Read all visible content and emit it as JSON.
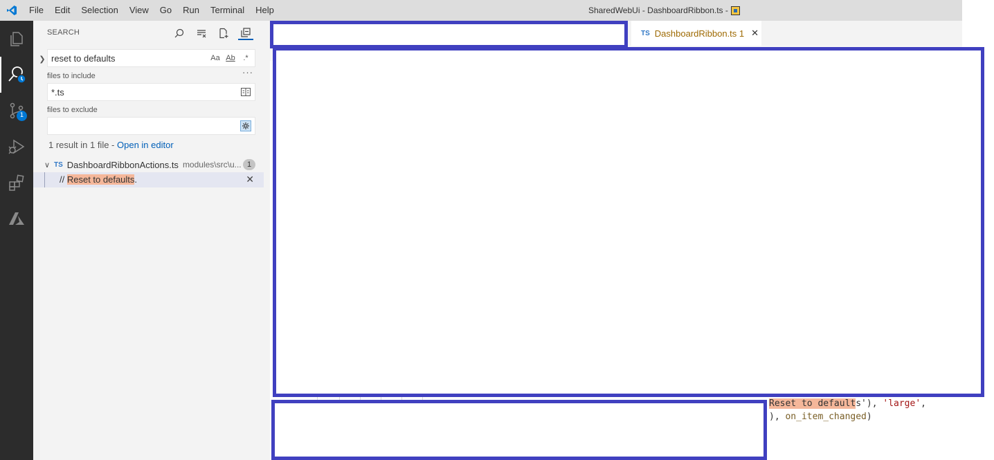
{
  "titlebar": {
    "menu": [
      "File",
      "Edit",
      "Selection",
      "View",
      "Go",
      "Run",
      "Terminal",
      "Help"
    ],
    "window_title": "SharedWebUi - DashboardRibbon.ts -"
  },
  "activitybar": {
    "items": [
      {
        "icon": "explorer-icon"
      },
      {
        "icon": "search-icon"
      },
      {
        "icon": "source-control-icon",
        "badge": "1"
      },
      {
        "icon": "run-debug-icon"
      },
      {
        "icon": "extensions-icon"
      },
      {
        "icon": "azure-icon"
      }
    ]
  },
  "sidebar": {
    "title": "SEARCH",
    "search": {
      "value": "reset to defaults",
      "match_case_label": "Aa",
      "whole_word_label": "Ab",
      "regex_label": ".*"
    },
    "include": {
      "label": "files to include",
      "value": "*.ts"
    },
    "exclude": {
      "label": "files to exclude",
      "value": ""
    },
    "summary": {
      "text": "1 result in 1 file - ",
      "link": "Open in editor"
    },
    "results": [
      {
        "lang": "TS",
        "file": "DashboardRibbonActions.ts",
        "path": "modules\\src\\u...",
        "count": "1",
        "matches": [
          {
            "prefix": "// ",
            "highlight": "Reset to defaults",
            "suffix": "."
          }
        ]
      }
    ]
  },
  "editor": {
    "tab": {
      "lang": "TS",
      "label": "DashboardRibbon.ts 1"
    },
    "code_lines": [
      {
        "highlight": "Reset to default",
        "rest": "s'), ",
        "str": "'large'",
        "tail": ","
      },
      {
        "prefix": "), ",
        "id": "on_item_changed",
        "tail": ")"
      }
    ]
  },
  "colors": {
    "accent": "#005fb8",
    "placeholder_border": "#4040c0",
    "match_highlight": "#f5b79a",
    "activity_bar": "#2c2c2c"
  }
}
